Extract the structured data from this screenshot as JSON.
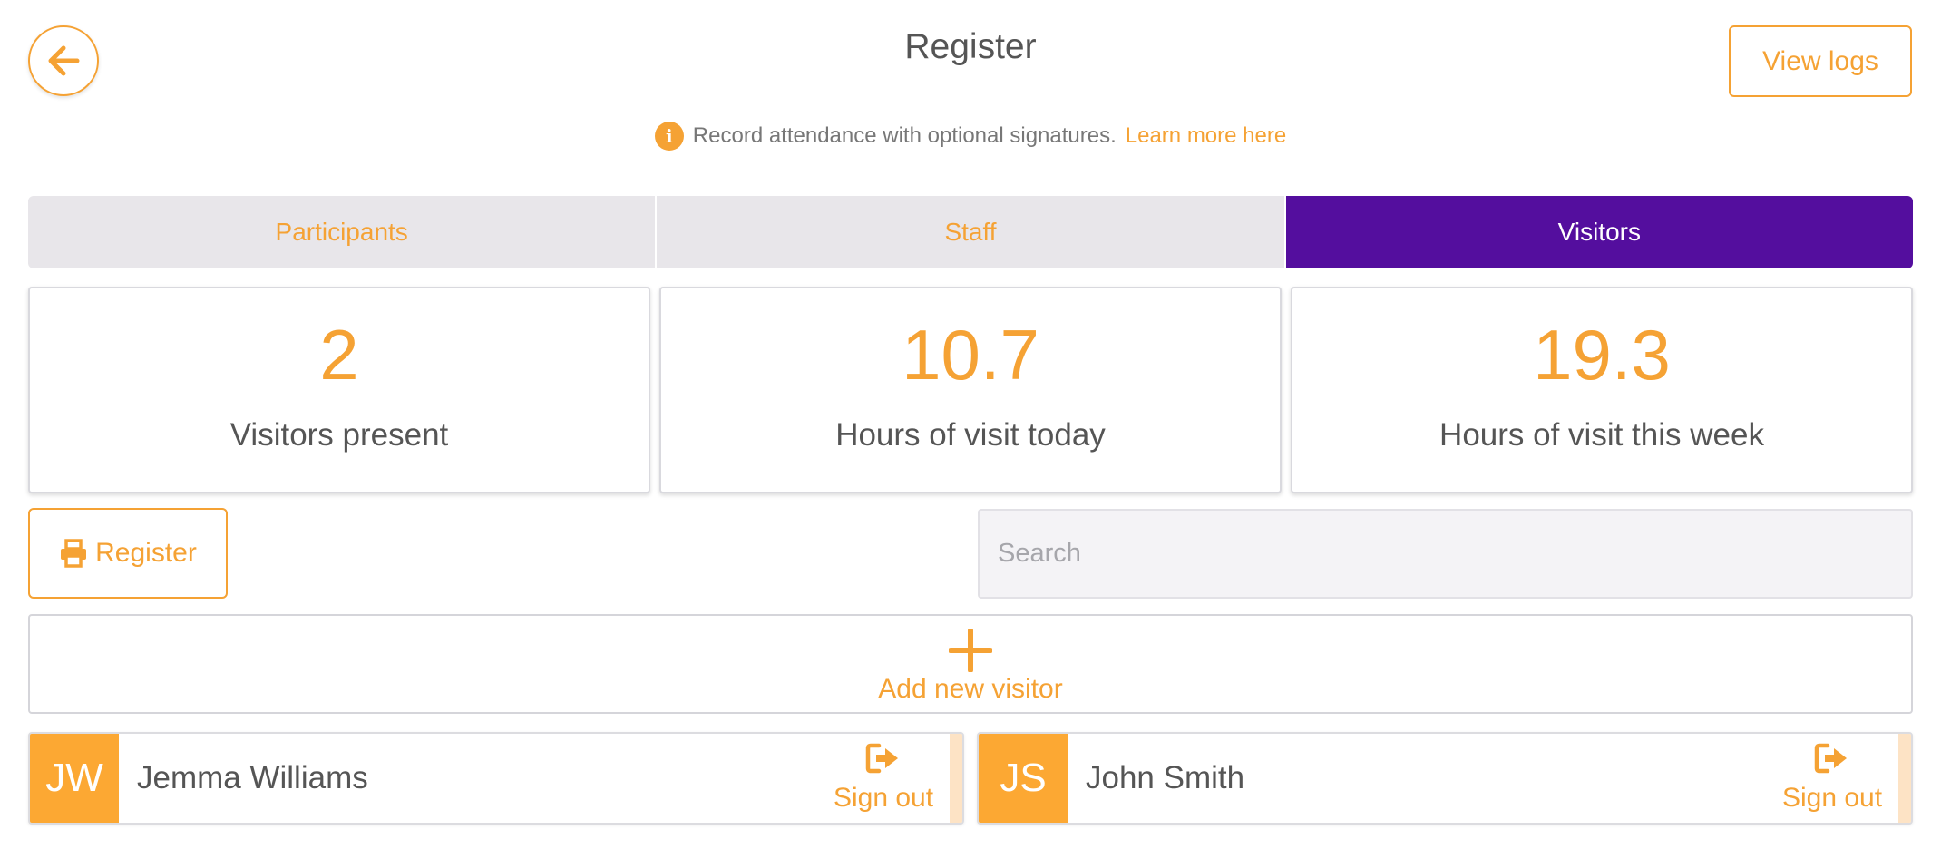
{
  "header": {
    "title": "Register",
    "view_logs_label": "View logs",
    "back_icon": "arrow-left-icon"
  },
  "info": {
    "text": "Record attendance with optional signatures.",
    "link_label": "Learn more here",
    "icon": "info-icon"
  },
  "tabs": [
    {
      "label": "Participants",
      "active": false
    },
    {
      "label": "Staff",
      "active": false
    },
    {
      "label": "Visitors",
      "active": true
    }
  ],
  "stats": [
    {
      "value": "2",
      "label": "Visitors present"
    },
    {
      "value": "10.7",
      "label": "Hours of visit today"
    },
    {
      "value": "19.3",
      "label": "Hours of visit this week"
    }
  ],
  "toolbar": {
    "register_label": "Register",
    "search_placeholder": "Search",
    "search_value": ""
  },
  "add_visitor": {
    "label": "Add new visitor"
  },
  "visitors": [
    {
      "initials": "JW",
      "name": "Jemma Williams",
      "action_label": "Sign out"
    },
    {
      "initials": "JS",
      "name": "John Smith",
      "action_label": "Sign out"
    }
  ],
  "colors": {
    "accent": "#f5a234",
    "active_tab": "#540e9e",
    "avatar": "#fca833",
    "text": "#555555"
  }
}
